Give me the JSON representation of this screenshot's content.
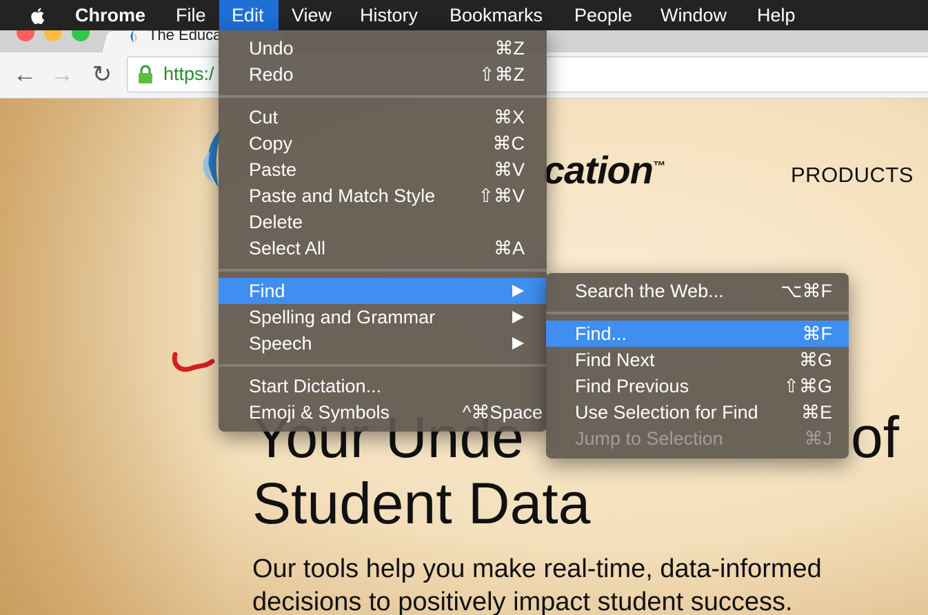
{
  "menubar": {
    "apple_icon": "apple-icon",
    "items": [
      "Chrome",
      "File",
      "Edit",
      "View",
      "History",
      "Bookmarks",
      "People",
      "Window",
      "Help"
    ],
    "active": "Edit"
  },
  "browser": {
    "tab_title": "The Educa",
    "url": "https:/",
    "colors": {
      "url_green": "#1e8e2a",
      "menubar_highlight": "#1f6fd6",
      "menu_highlight": "#3f8ef0"
    }
  },
  "page": {
    "logo_text": "cation",
    "logo_tm": "™",
    "nav_products": "PRODUCTS",
    "hero_line1": "Your Unde",
    "hero_line1_end": "of",
    "hero_line2": "Student Data",
    "subtitle_line1": "Our tools help you make real-time, data-informed",
    "subtitle_line2": "decisions to positively impact student success."
  },
  "edit_menu": {
    "items": [
      {
        "label": "Undo",
        "shortcut": "⌘Z"
      },
      {
        "label": "Redo",
        "shortcut": "⇧⌘Z"
      },
      {
        "label": "Cut",
        "shortcut": "⌘X"
      },
      {
        "label": "Copy",
        "shortcut": "⌘C"
      },
      {
        "label": "Paste",
        "shortcut": "⌘V"
      },
      {
        "label": "Paste and Match Style",
        "shortcut": "⇧⌘V"
      },
      {
        "label": "Delete",
        "shortcut": ""
      },
      {
        "label": "Select All",
        "shortcut": "⌘A"
      },
      {
        "label": "Find",
        "shortcut": "",
        "submenu": true,
        "highlighted": true
      },
      {
        "label": "Spelling and Grammar",
        "shortcut": "",
        "submenu": true
      },
      {
        "label": "Speech",
        "shortcut": "",
        "submenu": true
      },
      {
        "label": "Start Dictation...",
        "shortcut": ""
      },
      {
        "label": "Emoji & Symbols",
        "shortcut": "^⌘Space"
      }
    ]
  },
  "find_submenu": {
    "items": [
      {
        "label": "Search the Web...",
        "shortcut": "⌥⌘F"
      },
      {
        "label": "Find...",
        "shortcut": "⌘F",
        "highlighted": true
      },
      {
        "label": "Find Next",
        "shortcut": "⌘G"
      },
      {
        "label": "Find Previous",
        "shortcut": "⇧⌘G"
      },
      {
        "label": "Use Selection for Find",
        "shortcut": "⌘E"
      },
      {
        "label": "Jump to Selection",
        "shortcut": "⌘J",
        "disabled": true
      }
    ]
  }
}
